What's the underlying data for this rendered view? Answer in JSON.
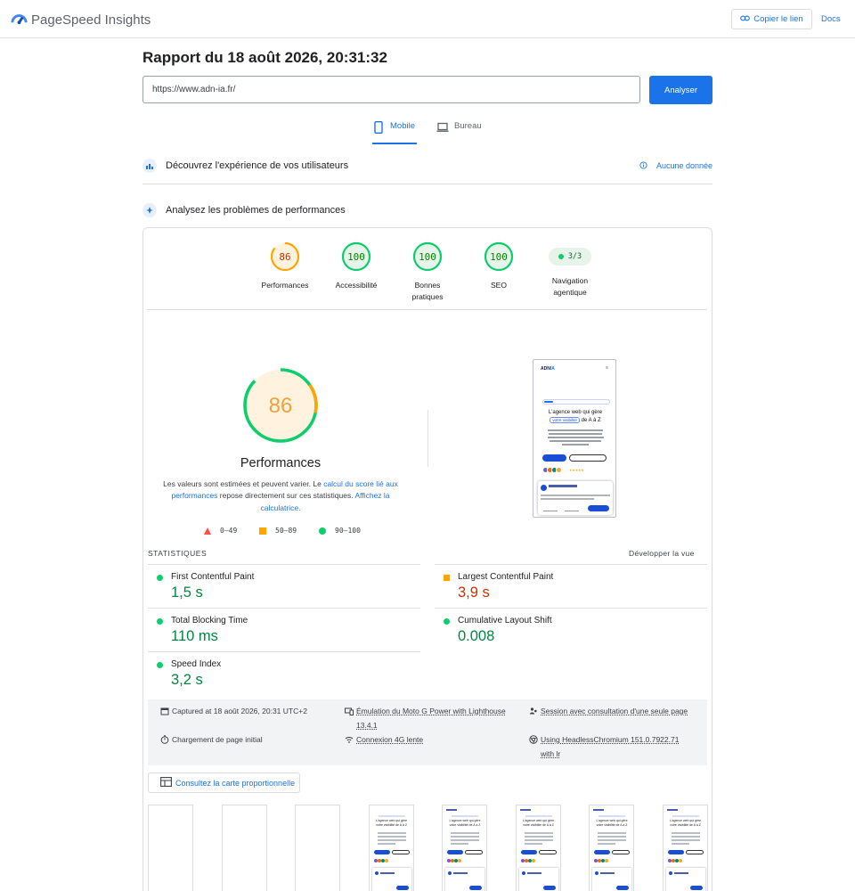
{
  "app": {
    "brand": "PageSpeed Insights",
    "copy_link": "Copier le lien",
    "docs": "Docs"
  },
  "report": {
    "title": "Rapport du 18 août 2026, 20:31:32",
    "url": "https://www.adn-ia.fr/",
    "analyze": "Analyser"
  },
  "tabs": [
    {
      "label": "Mobile",
      "icon": "smartphone-icon",
      "active": true
    },
    {
      "label": "Bureau",
      "icon": "laptop-icon",
      "active": false
    }
  ],
  "sections": {
    "crux": {
      "title": "Découvrez l'expérience de vos utilisateurs",
      "status": "Aucune donnée",
      "icon": "users-icon"
    },
    "lab": {
      "title": "Analysez les problèmes de performances",
      "icon": "lighthouse-icon"
    }
  },
  "scores": [
    {
      "label": "Performances",
      "value": "86",
      "score": 86,
      "color": "#ffa400",
      "text_color": "#c33300",
      "bg": "#fff3e0"
    },
    {
      "label": "Accessibilité",
      "value": "100",
      "score": 100,
      "color": "#0cce6b",
      "text_color": "#008800",
      "bg": "#e6f4ea"
    },
    {
      "label": "Bonnes pratiques",
      "value": "100",
      "score": 100,
      "color": "#0cce6b",
      "text_color": "#008800",
      "bg": "#e6f4ea"
    },
    {
      "label": "SEO",
      "value": "100",
      "score": 100,
      "color": "#0cce6b",
      "text_color": "#008800",
      "bg": "#e6f4ea"
    }
  ],
  "agentic": {
    "label": "Navigation agentique",
    "value": "3/3"
  },
  "performance": {
    "score": "86",
    "title": "Performances",
    "desc_1": "Les valeurs sont estimées et peuvent varier. Le ",
    "link_1": "calcul du score lié aux performances",
    "desc_2": " repose directement sur ces statistiques. ",
    "link_2": "Affichez la calculatrice.",
    "legend": [
      {
        "range": "0–49",
        "shape": "triangle",
        "color": "#ff4e42"
      },
      {
        "range": "50–89",
        "shape": "square",
        "color": "#ffa400"
      },
      {
        "range": "90–100",
        "shape": "circle",
        "color": "#0cce6b"
      }
    ]
  },
  "screenshot": {
    "logo_main": "ADN",
    "logo_accent": "IA",
    "menu": "≡",
    "headline_1": "L'agence web qui gère",
    "headline_hl": "votre visibilité",
    "headline_2": " de A à Z",
    "stars": "★★★★★"
  },
  "stats": {
    "heading": "STATISTIQUES",
    "expand": "Développer la vue",
    "metrics": [
      {
        "name": "First Contentful Paint",
        "value": "1,5 s",
        "rating": "good"
      },
      {
        "name": "Largest Contentful Paint",
        "value": "3,9 s",
        "rating": "average"
      },
      {
        "name": "Total Blocking Time",
        "value": "110 ms",
        "rating": "good"
      },
      {
        "name": "Cumulative Layout Shift",
        "value": "0.008",
        "rating": "good"
      },
      {
        "name": "Speed Index",
        "value": "3,2 s",
        "rating": "good"
      }
    ]
  },
  "environment": {
    "captured": "Captured at 18 août 2026, 20:31 UTC+2",
    "emulation_1": "Émulation du Moto G Power with Lighthouse",
    "emulation_2": "13.4.1",
    "session": "Session avec consultation d'une seule page",
    "load": "Chargement de page initial",
    "network": "Connexion 4G lente",
    "browser_1": "Using HeadlessChromium 151.0.7922.71",
    "browser_2": "with lr"
  },
  "treemap": {
    "label": "Consultez la carte proportionnelle",
    "icon": "treemap-icon"
  },
  "filmstrip": {
    "frames": 8
  }
}
